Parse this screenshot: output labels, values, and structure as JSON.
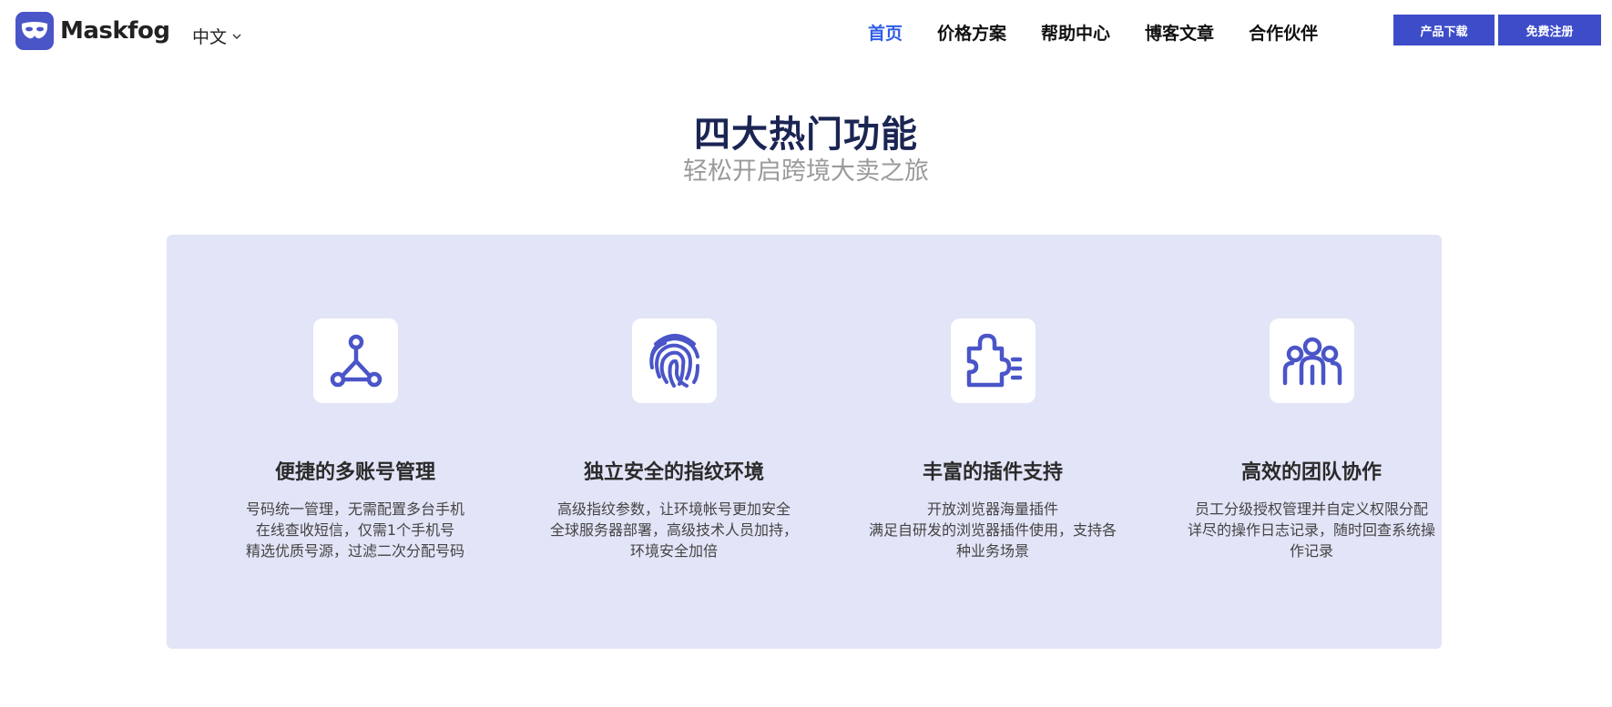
{
  "header": {
    "brand": "Maskfog",
    "language": "中文",
    "nav": [
      {
        "label": "首页",
        "active": true
      },
      {
        "label": "价格方案",
        "active": false
      },
      {
        "label": "帮助中心",
        "active": false
      },
      {
        "label": "博客文章",
        "active": false
      },
      {
        "label": "合作伙伴",
        "active": false
      }
    ],
    "download_label": "产品下载",
    "register_label": "免费注册"
  },
  "section": {
    "title": "四大热门功能",
    "subtitle": "轻松开启跨境大卖之旅"
  },
  "features": [
    {
      "icon": "network-nodes-icon",
      "title": "便捷的多账号管理",
      "desc": [
        "号码统一管理，无需配置多台手机",
        "在线查收短信，仅需1个手机号",
        "精选优质号源，过滤二次分配号码"
      ]
    },
    {
      "icon": "fingerprint-icon",
      "title": "独立安全的指纹环境",
      "desc": [
        "高级指纹参数，让环境帐号更加安全",
        "全球服务器部署，高级技术人员加持，",
        "环境安全加倍"
      ]
    },
    {
      "icon": "puzzle-plugin-icon",
      "title": "丰富的插件支持",
      "desc": [
        "开放浏览器海量插件",
        "满足自研发的浏览器插件使用，支持各",
        "种业务场景"
      ]
    },
    {
      "icon": "team-group-icon",
      "title": "高效的团队协作",
      "desc": [
        "员工分级授权管理并自定义权限分配",
        "详尽的操作日志记录，随时回查系统操",
        "作记录"
      ]
    }
  ],
  "colors": {
    "accent": "#3d4dc9",
    "nav_active": "#2f5de8",
    "panel_bg": "#e2e4f7",
    "icon": "#4a55c8",
    "title": "#1b2553"
  }
}
